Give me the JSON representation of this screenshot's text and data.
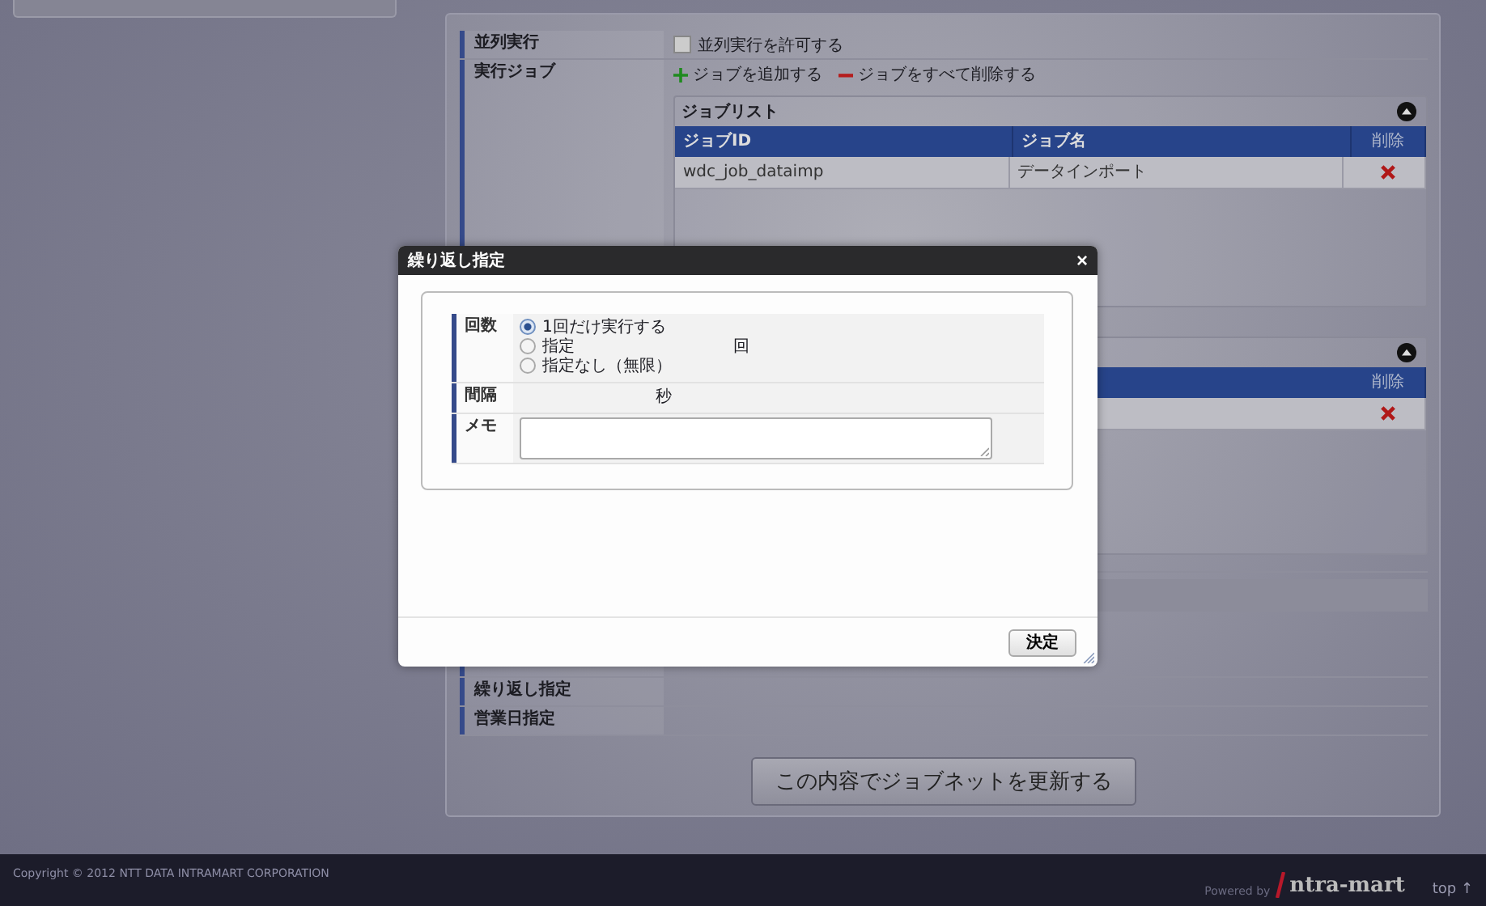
{
  "parallel": {
    "label": "並列実行",
    "option": "並列実行を許可する",
    "checked": false
  },
  "jobs": {
    "label": "実行ジョブ",
    "actions": [
      {
        "kind": "add",
        "label": "ジョブを追加する"
      },
      {
        "kind": "remove",
        "label": "ジョブをすべて削除する"
      }
    ],
    "lists": [
      {
        "title": "ジョブリスト",
        "expanded": true,
        "columns": [
          "ジョブID",
          "ジョブ名",
          "削除"
        ],
        "rows": [
          {
            "cells": [
              "wdc_job_dataimp",
              "データインポート"
            ]
          }
        ]
      },
      {
        "expanded": true,
        "columns": [
          "削除"
        ],
        "rows": [
          {
            "cells": []
          }
        ]
      }
    ]
  },
  "schedule_rows": [
    {
      "label": "繰り返し指定"
    },
    {
      "label": "営業日指定"
    }
  ],
  "submit_button": "この内容でジョブネットを更新する",
  "footer": {
    "copyright": "Copyright © 2012 NTT DATA INTRAMART CORPORATION",
    "powered_by": "Powered by",
    "logo": "ntra-mart",
    "top_link": "top ↑"
  },
  "dialog": {
    "title": "繰り返し指定",
    "close": "×",
    "fields": [
      {
        "kind": "radio",
        "label": "回数",
        "options": [
          {
            "label": "1回だけ実行する",
            "selected": true
          },
          {
            "label": "指定",
            "suffix": "回",
            "selected": false
          },
          {
            "label": "指定なし（無限）",
            "selected": false
          }
        ]
      },
      {
        "kind": "interval",
        "label": "間隔",
        "suffix": "秒"
      },
      {
        "kind": "memo",
        "label": "メモ"
      }
    ],
    "ok_button": "決定"
  }
}
